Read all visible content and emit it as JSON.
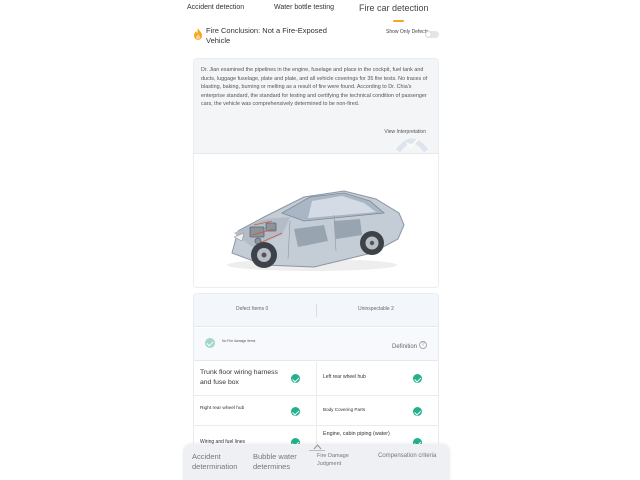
{
  "tabs": [
    {
      "label": "Accident detection"
    },
    {
      "label": "Water bottle testing"
    },
    {
      "label": "Fire car detection"
    }
  ],
  "conclusion": {
    "text": "Fire Conclusion: Not a Fire-Exposed Vehicle",
    "icon": "fire-icon",
    "icon_color": "#f5a623"
  },
  "toggle": {
    "label": "Show Only Defects",
    "on": false
  },
  "description": {
    "text": "Dr. Jian examined the pipelines in the engine, fuselage and place in the cockpit, fuel tank and ducts, luggage fuselage, plate and plate, and all vehicle coverings for 35 fire tests. No traces of blasting, baking, burning or melting as a result of fire were found. According to Dr. Chia's enterprise standard, the standard for testing and certifying the technical condition of passenger cars, the vehicle was comprehensively determined to be non-fired.",
    "view_label": "View Interpretation"
  },
  "stats": {
    "defect_label": "Defect Items 0",
    "uninspectable_label": "Uninspectable 2"
  },
  "sub": {
    "label": "No Fire damage items",
    "definition": "Definition",
    "help": "?"
  },
  "items": [
    {
      "left": "Trunk floor wiring harness and fuse box",
      "right": "Left rear wheel hub"
    },
    {
      "left": "Right rear wheel hub",
      "right": "Body Covering Parts"
    },
    {
      "left": "Wiring and fuel lines",
      "right": "Engine, cabin piping (water)"
    }
  ],
  "colors": {
    "accent": "#f5a623",
    "ok_green": "#23b08c",
    "check_light": "#9fd8c9"
  },
  "bottom_nav": [
    {
      "label": "Accident determination"
    },
    {
      "label": "Bubble water determines"
    },
    {
      "label": "Fire Damage Judgment"
    },
    {
      "label": "Compensation criteria"
    }
  ]
}
